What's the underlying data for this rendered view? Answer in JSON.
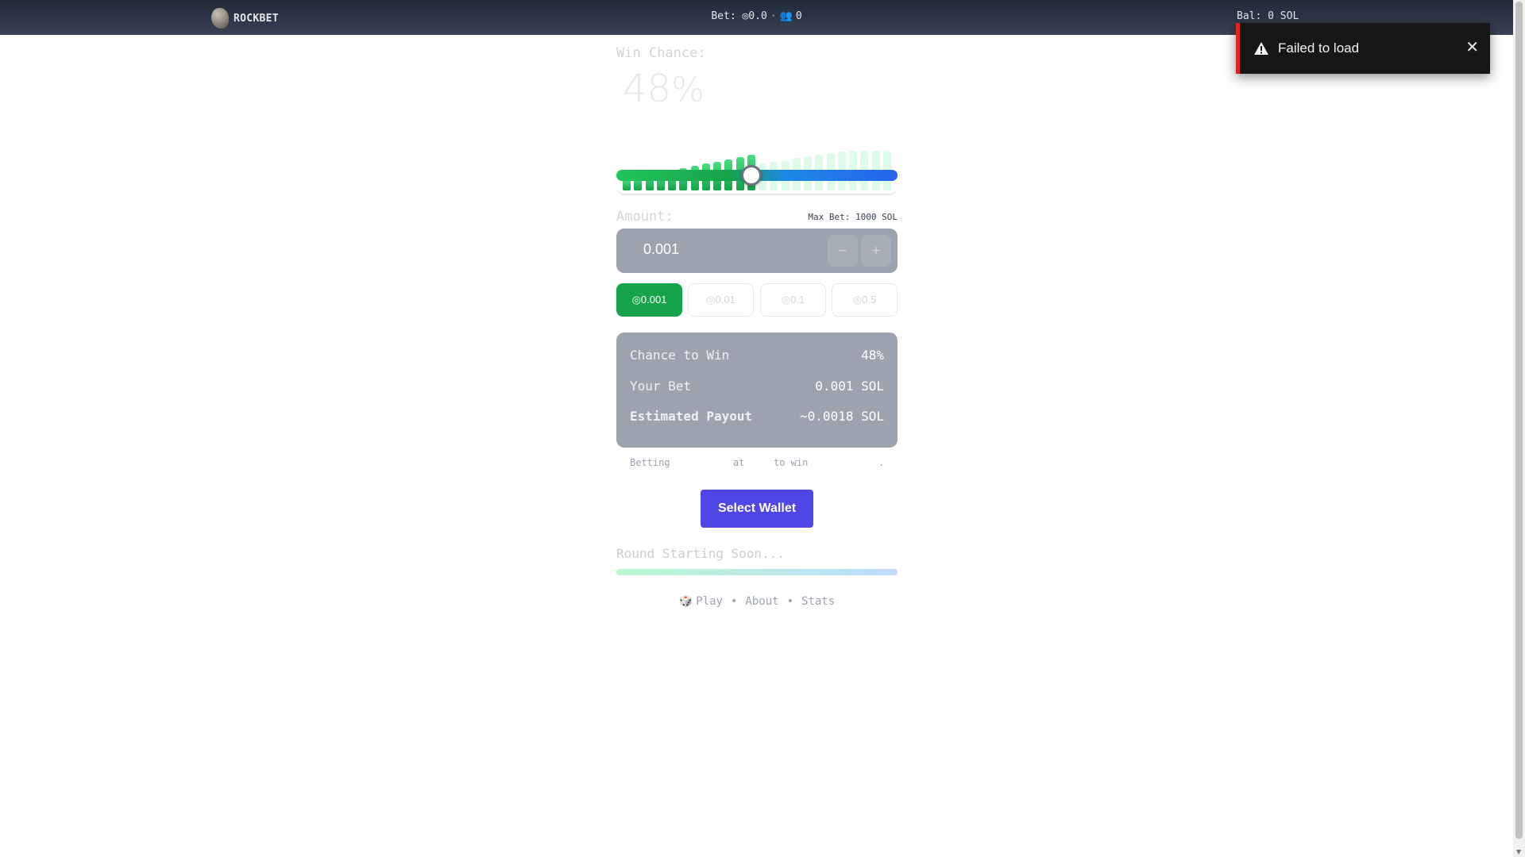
{
  "header": {
    "brand": "ROCKBET",
    "bet_label": "Bet: ◎0.0",
    "players": "0",
    "balance": "Bal: 0 SOL"
  },
  "toast": {
    "message": "Failed to load",
    "close": "✕"
  },
  "game": {
    "win_chance_label": "Win Chance:",
    "win_chance_value": "48",
    "win_chance_unit": "%",
    "win_chance_fraction": 0.48,
    "amount_label": "Amount:",
    "max_bet": "Max Bet: 1000 SOL",
    "amount_value": "0.001",
    "amount_coin": "◎",
    "decrement": "−",
    "increment": "+",
    "quick_amounts": [
      "◎0.001",
      "◎0.01",
      "◎0.1",
      "◎0.5"
    ],
    "selected_quick": 0
  },
  "summary": {
    "chance_label": "Chance to Win",
    "chance_value": "48%",
    "bet_label": "Your Bet",
    "bet_value": "0.001 SOL",
    "payout_label": "Estimated Payout",
    "payout_value": "~0.0018 SOL"
  },
  "betting_line": {
    "word1": "Betting",
    "word2": "at",
    "word3": "to win",
    "word4": "."
  },
  "wallet_button": "Select Wallet",
  "round": {
    "status": "Round Starting Soon..."
  },
  "footer": {
    "play": "Play",
    "about": "About",
    "stats": "Stats",
    "separator": "•"
  },
  "colors": {
    "accent_green": "#16a34a",
    "wallet_indigo": "#4f46e5",
    "toast_error": "#dc2626"
  }
}
